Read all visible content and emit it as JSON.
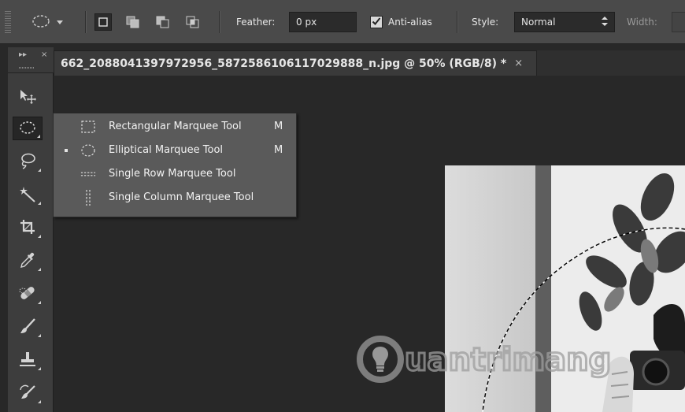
{
  "options_bar": {
    "feather_label": "Feather:",
    "feather_value": "0 px",
    "anti_alias_label": "Anti-alias",
    "anti_alias_checked": true,
    "style_label": "Style:",
    "style_value": "Normal",
    "width_label": "Width:"
  },
  "toolbar": {
    "collapse_label": "▸▸",
    "close_label": "×",
    "tools": [
      {
        "name": "move-tool"
      },
      {
        "name": "elliptical-marquee-tool",
        "active": true
      },
      {
        "name": "lasso-tool"
      },
      {
        "name": "magic-wand-tool"
      },
      {
        "name": "crop-tool"
      },
      {
        "name": "eyedropper-tool"
      },
      {
        "name": "spot-healing-brush-tool"
      },
      {
        "name": "brush-tool"
      },
      {
        "name": "clone-stamp-tool"
      },
      {
        "name": "history-brush-tool"
      }
    ]
  },
  "document_tab": {
    "title": "662_2088041397972956_5872586106117029888_n.jpg @ 50% (RGB/8) *",
    "close_label": "×"
  },
  "flyout": {
    "items": [
      {
        "label": "Rectangular Marquee Tool",
        "shortcut": "M",
        "selected": false,
        "icon": "rectangular-marquee-icon"
      },
      {
        "label": "Elliptical Marquee Tool",
        "shortcut": "M",
        "selected": true,
        "icon": "elliptical-marquee-icon"
      },
      {
        "label": "Single Row Marquee Tool",
        "shortcut": "",
        "selected": false,
        "icon": "single-row-marquee-icon"
      },
      {
        "label": "Single Column Marquee Tool",
        "shortcut": "",
        "selected": false,
        "icon": "single-column-marquee-icon"
      }
    ]
  },
  "watermark": {
    "text": "uantrimang"
  },
  "colors": {
    "panel_bg": "#4a4a4a",
    "canvas_bg": "#282828",
    "flyout_bg": "#5a5a5a",
    "field_bg": "#2b2b2b"
  }
}
